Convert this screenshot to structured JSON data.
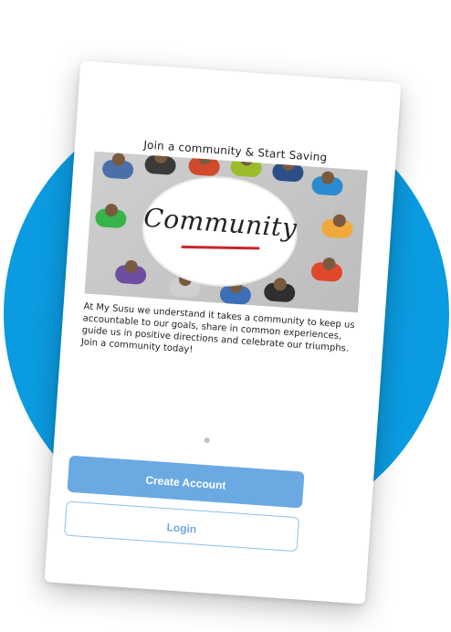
{
  "colors": {
    "circle_blue": "#0b9be0",
    "primary_button": "#6ba9e3",
    "secondary_border": "#8fc0ea",
    "secondary_text": "#6ba9e3",
    "underline_red": "#c9262a"
  },
  "onboarding": {
    "headline": "Join a community & Start Saving",
    "image_word": "Community",
    "body": "At My Susu we understand it takes a community to keep us accountable to our goals, share in common experiences, guide us in positive directions and celebrate our triumphs. Join a community today!",
    "page_indicator": {
      "current": 1,
      "total": 1
    }
  },
  "actions": {
    "create_account_label": "Create Account",
    "login_label": "Login"
  }
}
